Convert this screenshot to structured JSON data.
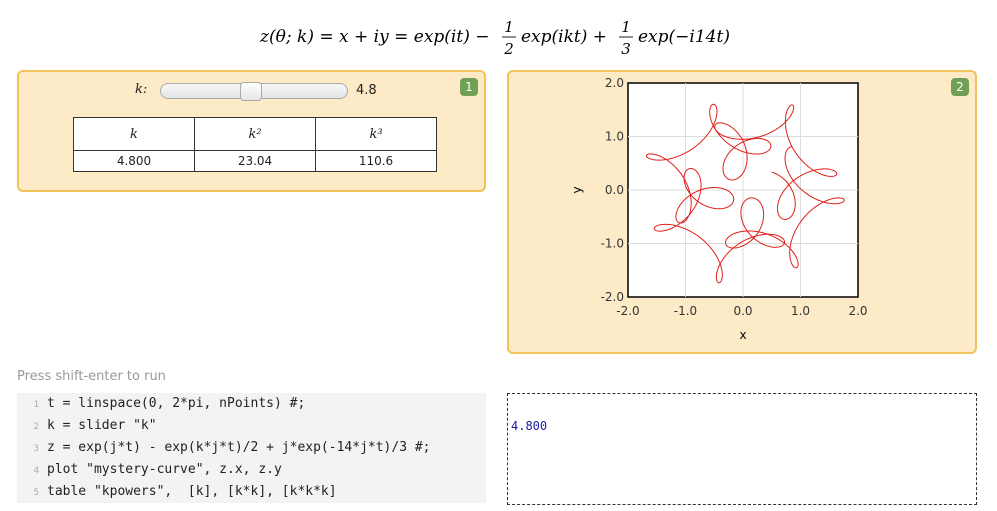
{
  "formula": "z(θ; k) = x + iy = exp(it) − ½ exp(ikt) + ⅓ exp(−i14t)",
  "panel1": {
    "badge": "1",
    "slider": {
      "label": "k:",
      "value": "4.8",
      "position": 0.48
    },
    "table": {
      "headers": [
        "k",
        "k²",
        "k³"
      ],
      "row": [
        "4.800",
        "23.04",
        "110.6"
      ]
    }
  },
  "panel2": {
    "badge": "2",
    "plot_color": "#e0201b"
  },
  "chart_data": {
    "type": "line",
    "title": "",
    "xlabel": "x",
    "ylabel": "y",
    "xlim": [
      -2.0,
      2.0
    ],
    "ylim": [
      -2.0,
      2.0
    ],
    "xticks": [
      "-2.0",
      "-1.0",
      "0.0",
      "1.0",
      "2.0"
    ],
    "yticks": [
      "2.0",
      "1.0",
      "0.0",
      "-1.0",
      "-2.0"
    ],
    "grid": true,
    "series": [
      {
        "expression": "x = cos t − cos(4.8 t)/2 + sin(14 t)/3, y = sin t − sin(4.8 t)/2 + cos(14 t)/3",
        "t_range": [
          0,
          6.2832
        ],
        "points": 1000
      }
    ]
  },
  "editor": {
    "hint": "Press shift-enter to run",
    "lines": [
      {
        "num": "1",
        "text": "t = linspace(0, 2*pi, nPoints) #;"
      },
      {
        "num": "2",
        "text": "k = slider \"k\""
      },
      {
        "num": "3",
        "text": "z = exp(j*t) - exp(k*j*t)/2 + j*exp(-14*j*t)/3 #;"
      },
      {
        "num": "4",
        "text": "plot \"mystery-curve\", z.x, z.y"
      },
      {
        "num": "5",
        "text": "table \"kpowers\",  [k], [k*k], [k*k*k]"
      }
    ]
  },
  "output": {
    "text": "4.800"
  }
}
